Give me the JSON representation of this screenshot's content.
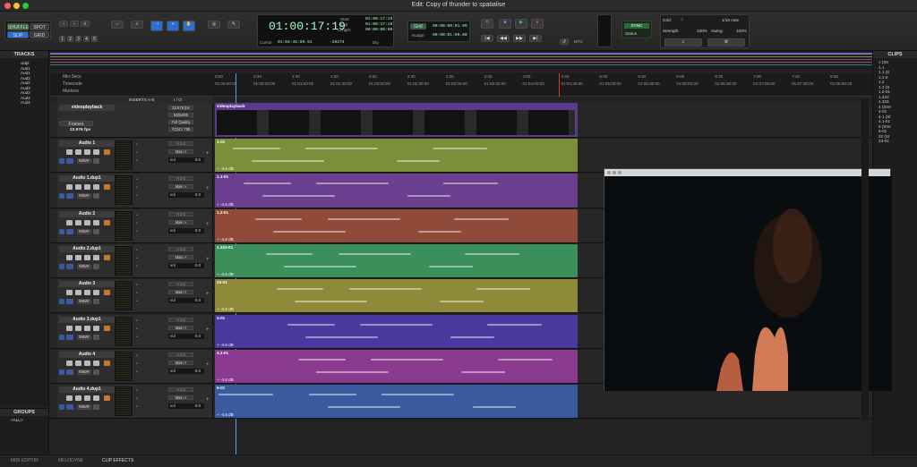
{
  "window": {
    "title": "Edit: Copy of thunder to spatialise"
  },
  "toolbar": {
    "modes": [
      "SHUFFLE",
      "SPOT",
      "SLIP",
      "GRID"
    ],
    "zoom_presets": [
      "1",
      "2",
      "3",
      "4",
      "5"
    ],
    "main_counter": "01:00:17:19",
    "start_label": "Start",
    "end_label": "End",
    "length_label": "Length:",
    "start_value": "01:00:17:19",
    "end_value": "01:00:17:19",
    "length_value": "00:00:00:00",
    "cursor_label": "Cursor",
    "cursor_value": "01:04:45:09.91",
    "cursor_extra": "-20274",
    "dly_label": "Dly",
    "grid_label": "Grid",
    "nudge_label": "Nudge",
    "grid_value": "00:00:00:01.00",
    "nudge_value": "00:00:01:00.00",
    "sync_label": "SYNC",
    "status_label": "Status",
    "mtc_label": "MTC",
    "right_grid_label": "Grid:",
    "right_grid_value": "1/16 note",
    "strength_label": "Strength:",
    "strength_value": "100%",
    "swing_label": "Swing:",
    "swing_value": "100%"
  },
  "tracks_panel": {
    "header": "TRACKS",
    "items": [
      "vidpl",
      "Aud1",
      "Aud1",
      "Aud2",
      "Aud2",
      "Aud3",
      "Aud3",
      "Aud4",
      "Aud4"
    ]
  },
  "groups_panel": {
    "header": "GROUPS",
    "items": [
      "<ALL>"
    ]
  },
  "clips_panel": {
    "header": "CLIPS",
    "items": [
      "1 (Str",
      "1.1",
      "1.1 (S",
      "1.1-0",
      "1.2",
      "1.2 (S",
      "1.2-01",
      "1.333",
      "1.333",
      "4 (Stre",
      "4-01",
      "4.1 (St",
      "4.1-01",
      "5 (Stre",
      "5-01",
      "22 (St",
      "23-01"
    ]
  },
  "rulers": {
    "labels": [
      "Min:Secs",
      "Timecode",
      "Markers"
    ],
    "minsecs": [
      "0:00",
      "0:30",
      "1:00",
      "1:30",
      "2:00",
      "2:30",
      "3:00",
      "3:30",
      "4:00",
      "4:30",
      "5:00",
      "5:30",
      "6:00",
      "6:30",
      "7:00",
      "7:30",
      "8:00"
    ],
    "timecode": [
      "01:00:00:00",
      "01:00:30:00",
      "01:01:00:00",
      "01:01:30:00",
      "01:02:00:00",
      "01:02:30:00",
      "01:03:00:00",
      "01:03:30:00",
      "01:04:00:00",
      "01:04:30:00",
      "01:05:00:00",
      "01:05:30:00",
      "01:06:00:00",
      "01:06:30:00",
      "01:07:00:00",
      "01:07:30:00",
      "01:08:00:00"
    ]
  },
  "column_headers": {
    "inserts": "INSERTS A-E",
    "io": "I / O"
  },
  "video_track": {
    "name": "videoplayback",
    "fps": "23.976 fps",
    "res": "640x480",
    "quality": "Full Quality",
    "codec": "YCbCr 709",
    "frames_label": "Frames",
    "clip_name": "videoplayback"
  },
  "audio_tracks": [
    {
      "name": "Audio 1",
      "input": "A 1-2",
      "output": "Main >",
      "vol_label": "vol",
      "vol": "0.0",
      "clip": "1-01",
      "gain": "-4.6 dB",
      "color": "#7b8f3a"
    },
    {
      "name": "Audio 1.dup1",
      "input": "A 1-2",
      "output": "Main >",
      "vol_label": "vol",
      "vol": "0.0",
      "clip": "1.1-01",
      "gain": "-4.6 dB",
      "color": "#6a3f8f"
    },
    {
      "name": "Audio 2",
      "input": "A 1-2",
      "output": "Main >",
      "vol_label": "vol",
      "vol": "0.0",
      "clip": "1.2-01",
      "gain": "-4.6 dB",
      "color": "#8f4a3a"
    },
    {
      "name": "Audio 2.dup1",
      "input": "A 1-2",
      "output": "Main >",
      "vol_label": "vol",
      "vol": "0.0",
      "clip": "1.333-01",
      "gain": "-4.6 dB",
      "color": "#3a8f5a"
    },
    {
      "name": "Audio 3",
      "input": "A 1-2",
      "output": "Main >",
      "vol_label": "vol",
      "vol": "0.0",
      "clip": "23-01",
      "gain": "-4.6 dB",
      "color": "#8f8a3a"
    },
    {
      "name": "Audio 3.dup1",
      "input": "A 1-2",
      "output": "Main >",
      "vol_label": "vol",
      "vol": "0.0",
      "clip": "4-01",
      "gain": "-4.6 dB",
      "color": "#4a3a9f"
    },
    {
      "name": "Audio 4",
      "input": "A 1-2",
      "output": "Main >",
      "vol_label": "vol",
      "vol": "0.0",
      "clip": "4.1-01",
      "gain": "-4.6 dB",
      "color": "#8a3a8f"
    },
    {
      "name": "Audio 4.dup1",
      "input": "A 1-2",
      "output": "Main >",
      "vol_label": "vol",
      "vol": "0.0",
      "clip": "5-01",
      "gain": "-4.6 dB",
      "color": "#3a5a9f"
    }
  ],
  "bottom_tabs": [
    "MIDI EDITOR",
    "MELODYNE",
    "CLIP EFFECTS"
  ]
}
